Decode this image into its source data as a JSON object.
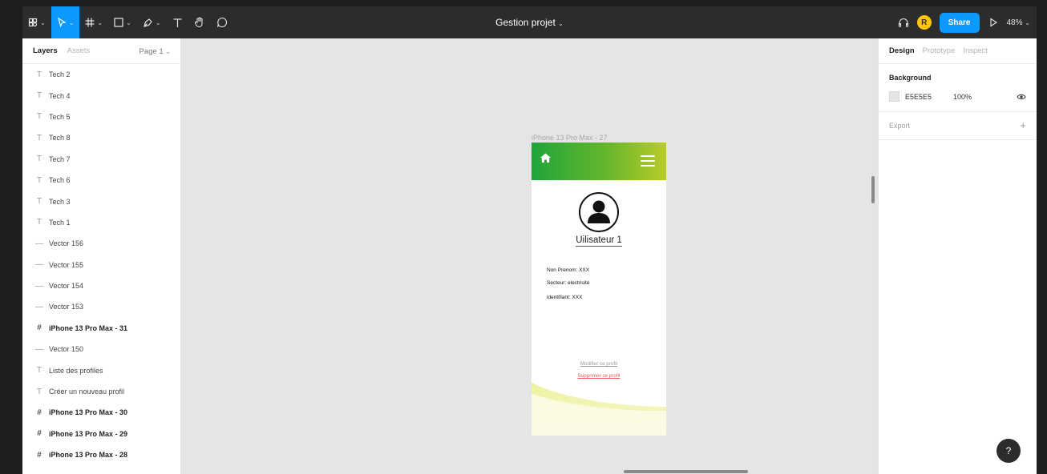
{
  "toolbar": {
    "title": "Gestion projet",
    "share_label": "Share",
    "avatar_initial": "R",
    "zoom": "48%",
    "accent": "#0d99ff"
  },
  "left_panel": {
    "tabs": [
      "Layers",
      "Assets"
    ],
    "page": "Page 1",
    "layers": [
      {
        "type": "text",
        "label": "Tech 2"
      },
      {
        "type": "text",
        "label": "Tech 4"
      },
      {
        "type": "text",
        "label": "Tech 5"
      },
      {
        "type": "text",
        "label": "Tech 8"
      },
      {
        "type": "text",
        "label": "Tech 7"
      },
      {
        "type": "text",
        "label": "Tech 6"
      },
      {
        "type": "text",
        "label": "Tech 3"
      },
      {
        "type": "text",
        "label": "Tech 1"
      },
      {
        "type": "vector",
        "label": "Vector 156"
      },
      {
        "type": "vector",
        "label": "Vector 155"
      },
      {
        "type": "vector",
        "label": "Vector 154"
      },
      {
        "type": "vector",
        "label": "Vector 153"
      },
      {
        "type": "frame",
        "label": "iPhone 13 Pro Max - 31"
      },
      {
        "type": "vector",
        "label": "Vector 150"
      },
      {
        "type": "text",
        "label": "Liste des profiles"
      },
      {
        "type": "text",
        "label": "Créer un nouveau profil"
      },
      {
        "type": "frame",
        "label": "iPhone 13 Pro Max - 30"
      },
      {
        "type": "frame",
        "label": "iPhone 13 Pro Max - 29"
      },
      {
        "type": "frame",
        "label": "iPhone 13 Pro Max - 28"
      }
    ]
  },
  "right_panel": {
    "tabs": [
      "Design",
      "Prototype",
      "Inspect"
    ],
    "background_label": "Background",
    "background_hex": "E5E5E5",
    "background_opacity": "100%",
    "export_label": "Export"
  },
  "canvas": {
    "frame_label": "iPhone 13 Pro Max - 27",
    "profile_name": "Uilisateur 1",
    "info": [
      "Non Prenom: XXX",
      "Secteur: electrisité",
      "identifiant: XXX"
    ],
    "link_edit": "Modifier ce profil",
    "link_delete": "Supprimer ce profil",
    "header_gradient": [
      "#1fa53a",
      "#b8cb2a"
    ],
    "delete_color": "#e85c5c"
  }
}
